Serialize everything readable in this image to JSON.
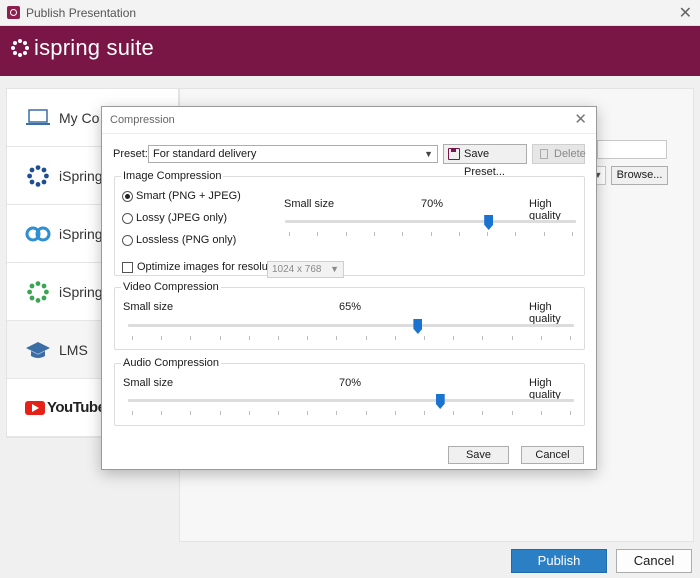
{
  "window": {
    "title": "Publish Presentation",
    "close_glyph": "✕"
  },
  "brand": {
    "name": "ispring suite",
    "color": "#7a1645"
  },
  "sidebar": {
    "items": [
      {
        "label": "My Co",
        "icon": "laptop-icon"
      },
      {
        "label": "iSpring",
        "icon": "ispring-logo-icon"
      },
      {
        "label": "iSpring",
        "icon": "ispring-cloud-icon"
      },
      {
        "label": "iSpring",
        "icon": "ispring-learn-icon"
      },
      {
        "label": "LMS",
        "icon": "graduation-cap-icon"
      },
      {
        "label": "YouTube",
        "icon": "youtube-logo-icon"
      }
    ]
  },
  "background": {
    "browse_label": "Browse..."
  },
  "footer": {
    "publish_label": "Publish",
    "cancel_label": "Cancel",
    "accent": "#2b7fc4"
  },
  "dialog": {
    "title": "Compression",
    "preset_label": "Preset:",
    "preset_value": "For standard delivery",
    "save_preset_label": "Save Preset...",
    "delete_label": "Delete",
    "image": {
      "group_title": "Image Compression",
      "radio_smart": "Smart (PNG + JPEG)",
      "radio_lossy": "Lossy (JPEG only)",
      "radio_lossless": "Lossless (PNG only)",
      "selected": "smart",
      "optimize_label": "Optimize images for resolution:",
      "optimize_checked": false,
      "resolution_value": "1024 x 768",
      "slider_min_label": "Small size",
      "slider_max_label": "High quality",
      "quality_text": "70%",
      "quality": 70
    },
    "video": {
      "group_title": "Video Compression",
      "slider_min_label": "Small size",
      "slider_max_label": "High quality",
      "quality_text": "65%",
      "quality": 65
    },
    "audio": {
      "group_title": "Audio Compression",
      "slider_min_label": "Small size",
      "slider_max_label": "High quality",
      "quality_text": "70%",
      "quality": 70
    },
    "save_label": "Save",
    "cancel_label": "Cancel",
    "slider_color": "#1a73d1"
  }
}
